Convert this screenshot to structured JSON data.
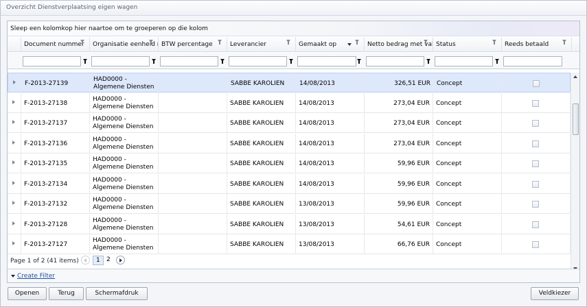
{
  "window": {
    "title": "Overzicht Dienstverplaatsing eigen wagen"
  },
  "grid": {
    "group_hint": "Sleep een kolomkop hier naartoe om te groeperen op die kolom",
    "columns": [
      {
        "label": "Document nummer",
        "has_filter_icon": true
      },
      {
        "label": "Organisatie eenheid na",
        "has_filter_icon": true
      },
      {
        "label": "BTW percentage",
        "has_filter_icon": true
      },
      {
        "label": "Leverancier",
        "has_filter_icon": true
      },
      {
        "label": "Gemaakt op",
        "has_filter_icon": true,
        "sorted": "descending"
      },
      {
        "label": "Netto bedrag met valu",
        "has_filter_icon": true
      },
      {
        "label": "Status",
        "has_filter_icon": true
      },
      {
        "label": "Reeds betaald",
        "has_filter_icon": true
      }
    ],
    "filter_row": [
      {
        "type": "text",
        "value": ""
      },
      {
        "type": "text",
        "value": ""
      },
      {
        "type": "text",
        "value": ""
      },
      {
        "type": "text",
        "value": ""
      },
      {
        "type": "dropdown",
        "value": ""
      },
      {
        "type": "text",
        "value": ""
      },
      {
        "type": "text",
        "value": ""
      },
      {
        "type": "dropdown",
        "value": ""
      }
    ],
    "rows": [
      {
        "doc": "F-2013-27139",
        "org_line1": "HAD0000 -",
        "org_line2": "Algemene Diensten",
        "btw": "",
        "supplier": "SABBE KAROLIEN",
        "created": "14/08/2013",
        "amount": "326,51 EUR",
        "status": "Concept",
        "paid": false,
        "selected": true
      },
      {
        "doc": "F-2013-27138",
        "org_line1": "HAD0000 -",
        "org_line2": "Algemene Diensten",
        "btw": "",
        "supplier": "SABBE KAROLIEN",
        "created": "14/08/2013",
        "amount": "273,04 EUR",
        "status": "Concept",
        "paid": false,
        "selected": false
      },
      {
        "doc": "F-2013-27137",
        "org_line1": "HAD0000 -",
        "org_line2": "Algemene Diensten",
        "btw": "",
        "supplier": "SABBE KAROLIEN",
        "created": "14/08/2013",
        "amount": "273,04 EUR",
        "status": "Concept",
        "paid": false,
        "selected": false
      },
      {
        "doc": "F-2013-27136",
        "org_line1": "HAD0000 -",
        "org_line2": "Algemene Diensten",
        "btw": "",
        "supplier": "SABBE KAROLIEN",
        "created": "14/08/2013",
        "amount": "273,04 EUR",
        "status": "Concept",
        "paid": false,
        "selected": false
      },
      {
        "doc": "F-2013-27135",
        "org_line1": "HAD0000 -",
        "org_line2": "Algemene Diensten",
        "btw": "",
        "supplier": "SABBE KAROLIEN",
        "created": "14/08/2013",
        "amount": "59,96 EUR",
        "status": "Concept",
        "paid": false,
        "selected": false
      },
      {
        "doc": "F-2013-27134",
        "org_line1": "HAD0000 -",
        "org_line2": "Algemene Diensten",
        "btw": "",
        "supplier": "SABBE KAROLIEN",
        "created": "14/08/2013",
        "amount": "59,96 EUR",
        "status": "Concept",
        "paid": false,
        "selected": false
      },
      {
        "doc": "F-2013-27132",
        "org_line1": "HAD0000 -",
        "org_line2": "Algemene Diensten",
        "btw": "",
        "supplier": "SABBE KAROLIEN",
        "created": "13/08/2013",
        "amount": "59,96 EUR",
        "status": "Concept",
        "paid": false,
        "selected": false
      },
      {
        "doc": "F-2013-27128",
        "org_line1": "HAD0000 -",
        "org_line2": "Algemene Diensten",
        "btw": "",
        "supplier": "SABBE KAROLIEN",
        "created": "13/08/2013",
        "amount": "54,61 EUR",
        "status": "Concept",
        "paid": false,
        "selected": false
      },
      {
        "doc": "F-2013-27127",
        "org_line1": "HAD0000 -",
        "org_line2": "Algemene Diensten",
        "btw": "",
        "supplier": "SABBE KAROLIEN",
        "created": "13/08/2013",
        "amount": "66,76 EUR",
        "status": "Concept",
        "paid": false,
        "selected": false
      }
    ],
    "pager": {
      "info": "Page 1 of 2 (41 items)",
      "pages": [
        "1",
        "2"
      ],
      "current_page": "1"
    },
    "create_filter_label": "Create Filter"
  },
  "buttons": {
    "open": "Openen",
    "back": "Terug",
    "print": "Schermafdruk",
    "field_chooser": "Veldkiezer"
  },
  "colors": {
    "selected_row": "#dde8fb",
    "link": "#1f4f9c",
    "border": "#b6c2cf"
  }
}
